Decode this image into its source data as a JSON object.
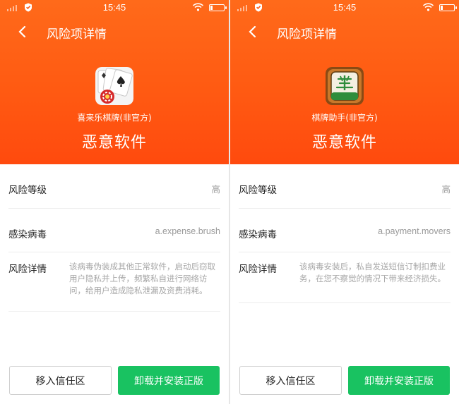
{
  "status_bar": {
    "time": "15:45"
  },
  "colors": {
    "header": "#ff5a12",
    "accent_green": "#19c261",
    "muted_text": "#9a9a9a"
  },
  "screens": [
    {
      "title": "风险项详情",
      "app_icon": "poker-cards-icon",
      "app_name": "喜来乐棋牌(非官方)",
      "verdict": "恶意软件",
      "risk_level_label": "风险等级",
      "risk_level_value": "高",
      "virus_label": "感染病毒",
      "virus_value": "a.expense.brush",
      "detail_label": "风险详情",
      "detail_text": "该病毒伪装成其他正常软件，启动后窃取用户隐私并上传，频繁私自进行网络访问，给用户造成隐私泄漏及资费消耗。",
      "trust_button": "移入信任区",
      "uninstall_button": "卸载并安装正版"
    },
    {
      "title": "风险项详情",
      "app_icon": "mahjong-tile-icon",
      "app_name": "棋牌助手(非官方)",
      "verdict": "恶意软件",
      "risk_level_label": "风险等级",
      "risk_level_value": "高",
      "virus_label": "感染病毒",
      "virus_value": "a.payment.movers",
      "detail_label": "风险详情",
      "detail_text": "该病毒安装后，私自发送短信订制扣费业务，在您不察觉的情况下带来经济损失。",
      "trust_button": "移入信任区",
      "uninstall_button": "卸载并安装正版"
    }
  ]
}
